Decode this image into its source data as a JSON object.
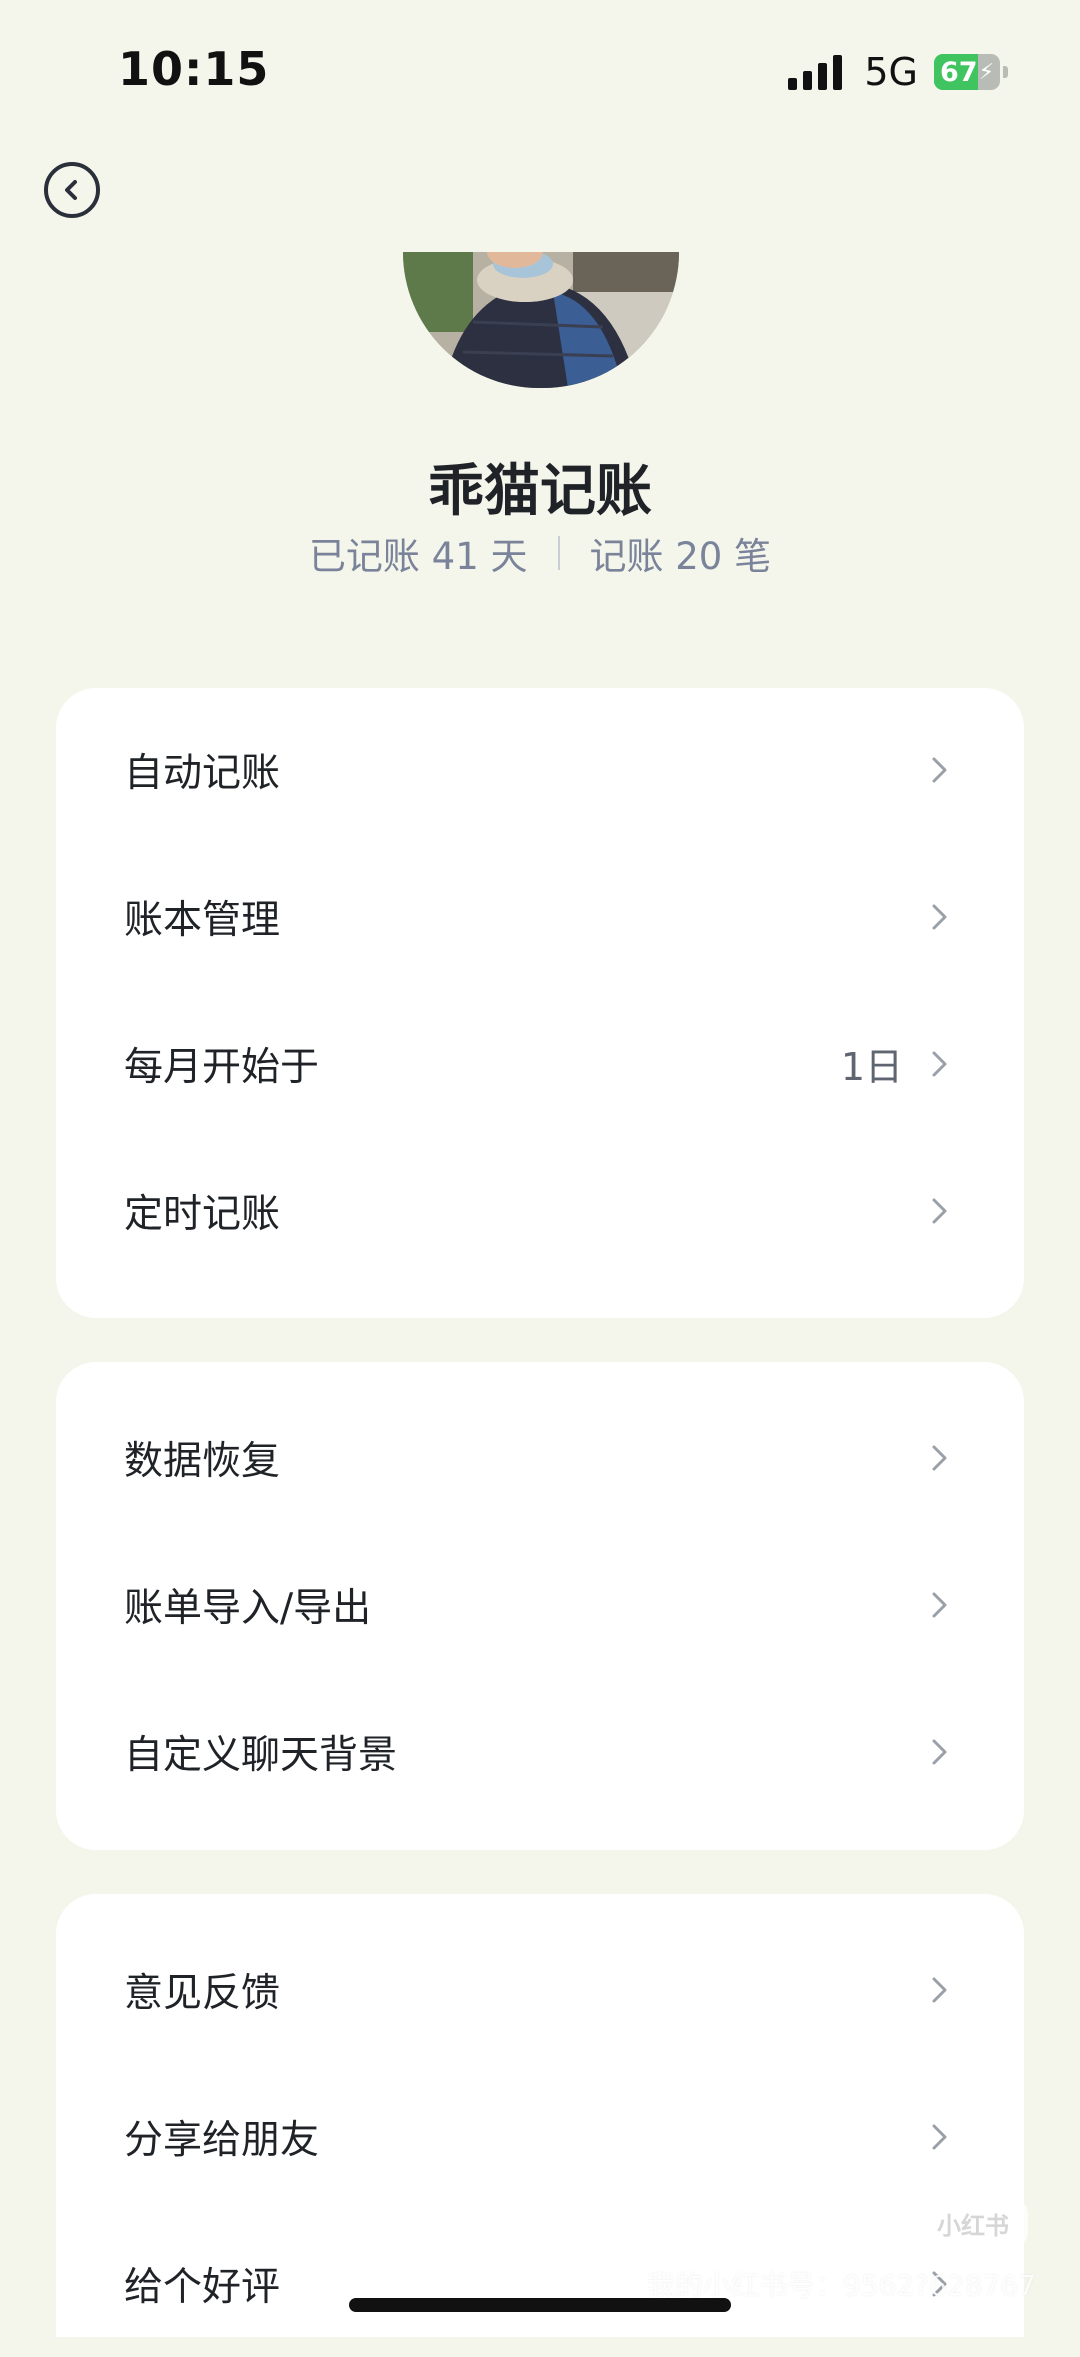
{
  "status_bar": {
    "time": "10:15",
    "network": "5G",
    "battery_level": "67",
    "battery_fraction": 0.67,
    "colors": {
      "battery_fill": "#3fc45f"
    }
  },
  "header": {
    "back_icon": "chevron-left-circle-icon"
  },
  "profile": {
    "name": "乖猫记账",
    "days_label": "已记账 41 天",
    "entries_label": "记账 20 笔"
  },
  "menu_groups": [
    {
      "items": [
        {
          "label": "自动记账",
          "value": ""
        },
        {
          "label": "账本管理",
          "value": ""
        },
        {
          "label": "每月开始于",
          "value": "1日"
        },
        {
          "label": "定时记账",
          "value": ""
        }
      ]
    },
    {
      "items": [
        {
          "label": "数据恢复",
          "value": ""
        },
        {
          "label": "账单导入/导出",
          "value": ""
        },
        {
          "label": "自定义聊天背景",
          "value": ""
        }
      ]
    },
    {
      "items": [
        {
          "label": "意见反馈",
          "value": ""
        },
        {
          "label": "分享给朋友",
          "value": ""
        },
        {
          "label": "给个好评",
          "value": ""
        }
      ]
    }
  ],
  "watermark": {
    "logo_text": "小红书",
    "text": "我的小红书号：9562?628767"
  },
  "colors": {
    "background": "#f4f6ec",
    "card": "#ffffff",
    "text_primary": "#1f2328",
    "text_secondary": "#7a8399",
    "chevron": "#9aa0a8"
  }
}
